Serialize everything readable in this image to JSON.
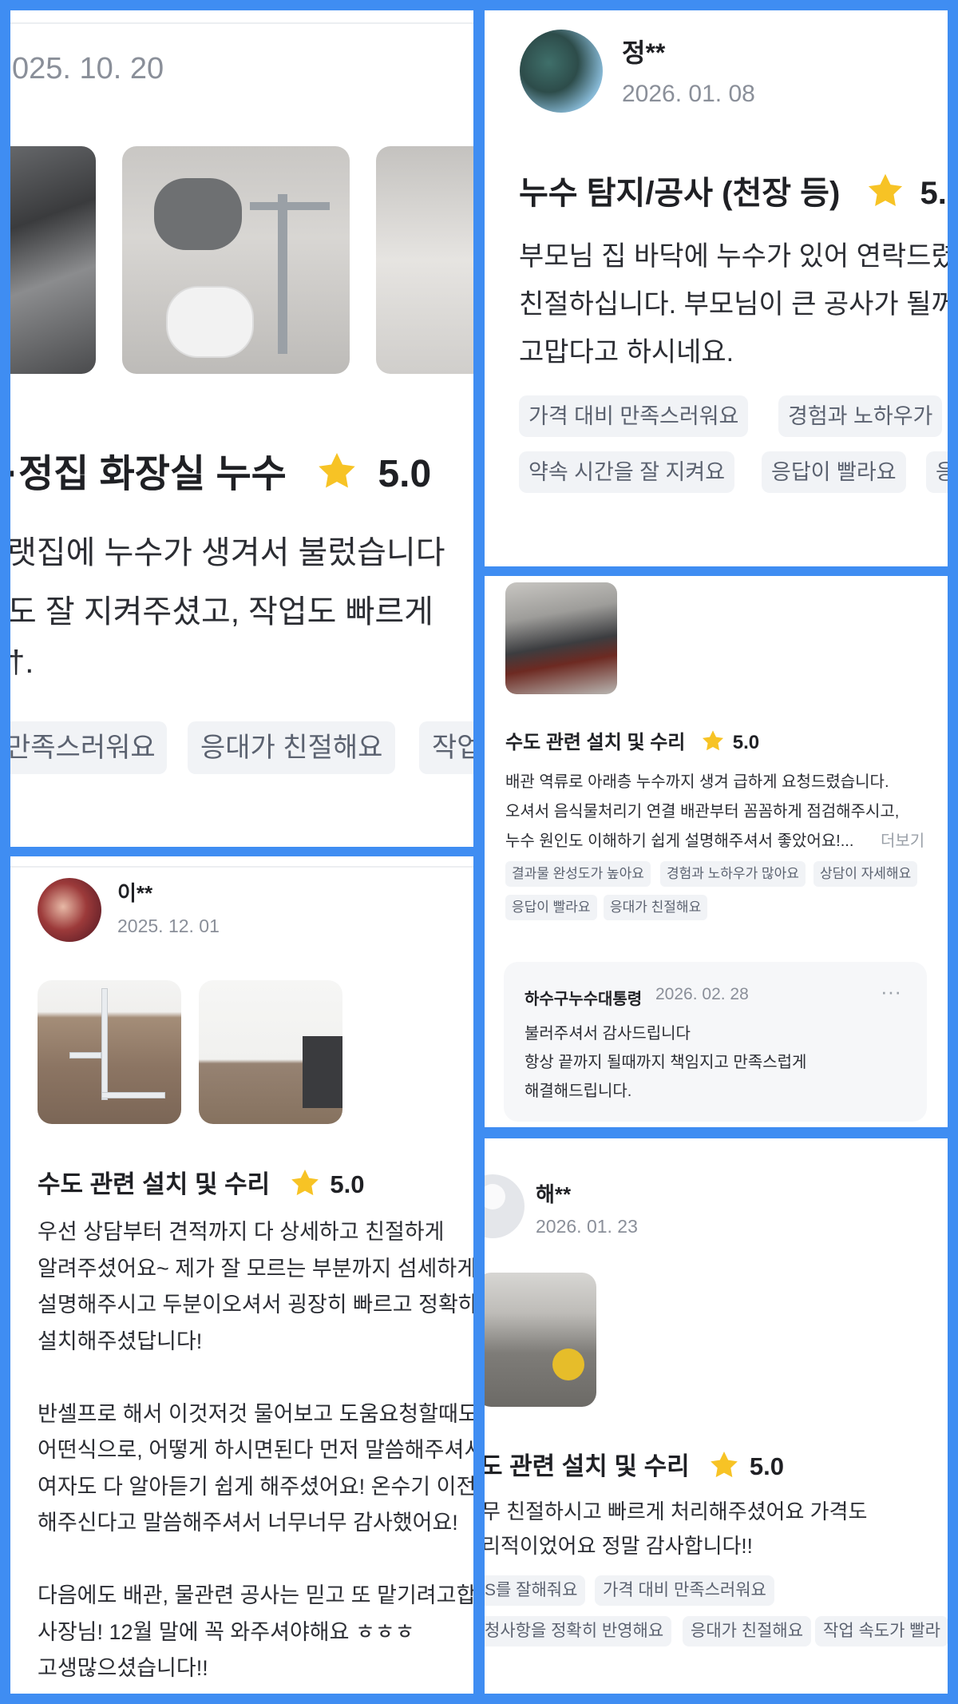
{
  "p1": {
    "date": "025. 10. 20",
    "title": "·정집 화장실 누수",
    "rating": "5.0",
    "body": [
      "랫집에 누수가 생겨서 불렀습니다",
      "도 잘 지켜주셨고, 작업도 빠르게",
      "†."
    ],
    "chips": [
      "만족스러워요",
      "응대가 친절해요",
      "작업"
    ]
  },
  "p2": {
    "name": "정**",
    "date": "2026. 01. 08",
    "title": "누수 탐지/공사 (천장 등)",
    "rating": "5.0",
    "body": [
      "부모님 집 바닥에 누수가 있어 연락드렸",
      "친절하십니다. 부모님이 큰 공사가 될꺼",
      "고맙다고 하시네요."
    ],
    "chips_row1": [
      "가격 대비 만족스러워요",
      "경험과 노하우가"
    ],
    "chips_row2": [
      "약속 시간을 잘 지켜요",
      "응답이 빨라요",
      "응"
    ]
  },
  "p3": {
    "title": "수도 관련 설치 및 수리",
    "rating": "5.0",
    "body": [
      "배관 역류로 아래층 누수까지 생겨 급하게 요청드렸습니다.",
      "오셔서 음식물처리기 연결 배관부터 꼼꼼하게 점검해주시고,",
      "누수 원인도 이해하기 쉽게 설명해주셔서 좋았어요!..."
    ],
    "more": "더보기",
    "chips_row1": [
      "결과물 완성도가 높아요",
      "경험과 노하우가 많아요",
      "상담이 자세해요"
    ],
    "chips_row2": [
      "응답이 빨라요",
      "응대가 친절해요"
    ],
    "reply": {
      "author": "하수구누수대통령",
      "date": "2026. 02. 28",
      "menu": "···",
      "lines": [
        "불러주셔서 감사드립니다",
        "항상 끝까지 될때까지 책임지고 만족스럽게",
        "해결해드립니다."
      ]
    }
  },
  "p4": {
    "name": "이**",
    "date": "2025. 12. 01",
    "title": "수도 관련 설치 및 수리",
    "rating": "5.0",
    "body": [
      "우선 상담부터 견적까지 다 상세하고 친절하게",
      "알려주셨어요~ 제가 잘 모르는 부분까지 섬세하게",
      "설명해주시고 두분이오셔서 굉장히 빠르고 정확하게",
      "설치해주셨답니다!",
      "",
      "반셀프로 해서 이것저것 물어보고 도움요청할때도",
      "어떤식으로, 어떻게 하시면된다 먼저 말씀해주셔서",
      "여자도 다 알아듣기 쉽게 해주셨어요! 온수기 이전",
      "해주신다고 말씀해주셔서 너무너무 감사했어요!",
      "",
      "다음에도 배관, 물관련 공사는 믿고 또 맡기려고합",
      "사장님! 12월 말에 꼭 와주셔야해요 ㅎㅎㅎ",
      "고생많으셨습니다!!"
    ]
  },
  "p5": {
    "name": "해**",
    "date": "2026. 01. 23",
    "title": "도 관련 설치 및 수리",
    "rating": "5.0",
    "body": [
      "무 친절하시고 빠르게 처리해주셨어요 가격도",
      "리적이었어요 정말 감사합니다!!"
    ],
    "chips_row1": [
      "S를 잘해줘요",
      "가격 대비 만족스러워요"
    ],
    "chips_row2": [
      "청사항을 정확히 반영해요",
      "응대가 친절해요",
      "작업 속도가 빨라"
    ]
  },
  "icons": [
    "star-icon",
    "more-icon"
  ],
  "colors": {
    "frame": "#3f8df2",
    "star": "#f7c325",
    "chip_bg": "#f1f3f6",
    "chip_text": "#5b6270"
  }
}
